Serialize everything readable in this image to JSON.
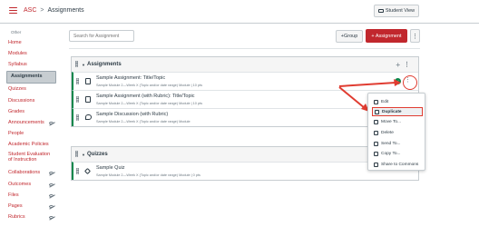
{
  "header": {
    "course": "ASC",
    "separator": ">",
    "current": "Assignments",
    "student_view": "Student View"
  },
  "sidebar": {
    "other_label": "Other",
    "items": [
      {
        "label": "Home",
        "hidden": false
      },
      {
        "label": "Modules",
        "hidden": false
      },
      {
        "label": "Syllabus",
        "hidden": false
      },
      {
        "label": "Assignments",
        "hidden": false,
        "active": true
      },
      {
        "label": "Quizzes",
        "hidden": false
      },
      {
        "label": "Discussions",
        "hidden": false
      },
      {
        "label": "Grades",
        "hidden": false
      },
      {
        "label": "Announcements",
        "hidden": true
      },
      {
        "label": "People",
        "hidden": false
      },
      {
        "label": "Academic Policies",
        "hidden": false
      },
      {
        "label": "Student Evaluation of Instruction",
        "hidden": false
      },
      {
        "label": "Collaborations",
        "hidden": true
      },
      {
        "label": "Outcomes",
        "hidden": true
      },
      {
        "label": "Files",
        "hidden": true
      },
      {
        "label": "Pages",
        "hidden": true
      },
      {
        "label": "Rubrics",
        "hidden": true
      }
    ]
  },
  "toolbar": {
    "search_placeholder": "Search for Assignment",
    "group_button": "+Group",
    "assignment_button": "+ Assignment",
    "kebab": "⋮"
  },
  "groups": [
    {
      "title": "Assignments",
      "rows": [
        {
          "title": "Sample Assignment: Title/Topic",
          "sub": "Sample Module 2—Week X (Topic and/or date range) Module  |  10 pts",
          "icon": "assignment-icon"
        },
        {
          "title": "Sample Assignment (with Rubric): Title/Topic",
          "sub": "Sample Module 2—Week X (Topic and/or date range) Module  |  10 pts",
          "icon": "assignment-icon"
        },
        {
          "title": "Sample Discussion (with Rubric)",
          "sub": "Sample Module 2—Week X (Topic and/or date range) Module",
          "icon": "discussion-icon"
        }
      ]
    },
    {
      "title": "Quizzes",
      "rows": [
        {
          "title": "Sample Quiz",
          "sub": "Sample Module 2—Week X (Topic and/or date range) Module  |  0 pts",
          "icon": "quiz-icon"
        }
      ]
    }
  ],
  "menu": {
    "items": [
      {
        "label": "Edit",
        "icon": "pencil-icon"
      },
      {
        "label": "Duplicate",
        "icon": "copy-icon",
        "highlighted": true
      },
      {
        "label": "Move To...",
        "icon": "move-icon"
      },
      {
        "label": "Delete",
        "icon": "trash-icon"
      },
      {
        "label": "Send To...",
        "icon": "send-icon"
      },
      {
        "label": "Copy To...",
        "icon": "copy-to-icon"
      },
      {
        "label": "Share to Commons",
        "icon": "commons-icon"
      }
    ]
  },
  "colors": {
    "brand_red": "#c1272d",
    "published_green": "#0b874b",
    "annotation_red": "#e03c31"
  }
}
